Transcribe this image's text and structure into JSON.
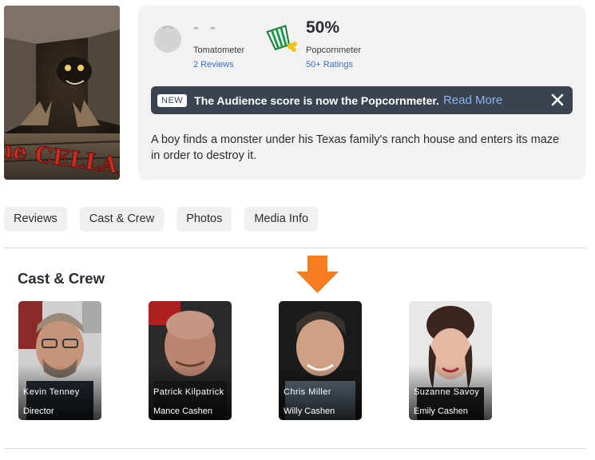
{
  "poster": {
    "title_art": "the CELLAR"
  },
  "scores": {
    "tomatometer": {
      "value": "- -",
      "label": "Tomatometer",
      "link": "2 Reviews"
    },
    "popcornmeter": {
      "value": "50%",
      "label": "Popcornmeter",
      "link": "50+ Ratings"
    }
  },
  "notice": {
    "badge": "NEW",
    "text": "The Audience score is now the Popcornmeter.",
    "link": "Read More"
  },
  "synopsis": "A boy finds a monster under his Texas family's ranch house and enters its maze in order to destroy it.",
  "tabs": [
    "Reviews",
    "Cast & Crew",
    "Photos",
    "Media Info"
  ],
  "cast_section": {
    "title": "Cast & Crew",
    "members": [
      {
        "name": "Kevin Tenney",
        "role": "Director"
      },
      {
        "name": "Patrick Kilpatrick",
        "role": "Mance Cashen"
      },
      {
        "name": "Chris Miller",
        "role": "Willy Cashen"
      },
      {
        "name": "Suzanne Savoy",
        "role": "Emily Cashen"
      }
    ]
  },
  "colors": {
    "accent_link": "#3a6fc4",
    "notice_bg": "#3b4350",
    "arrow": "#f57c1f"
  }
}
